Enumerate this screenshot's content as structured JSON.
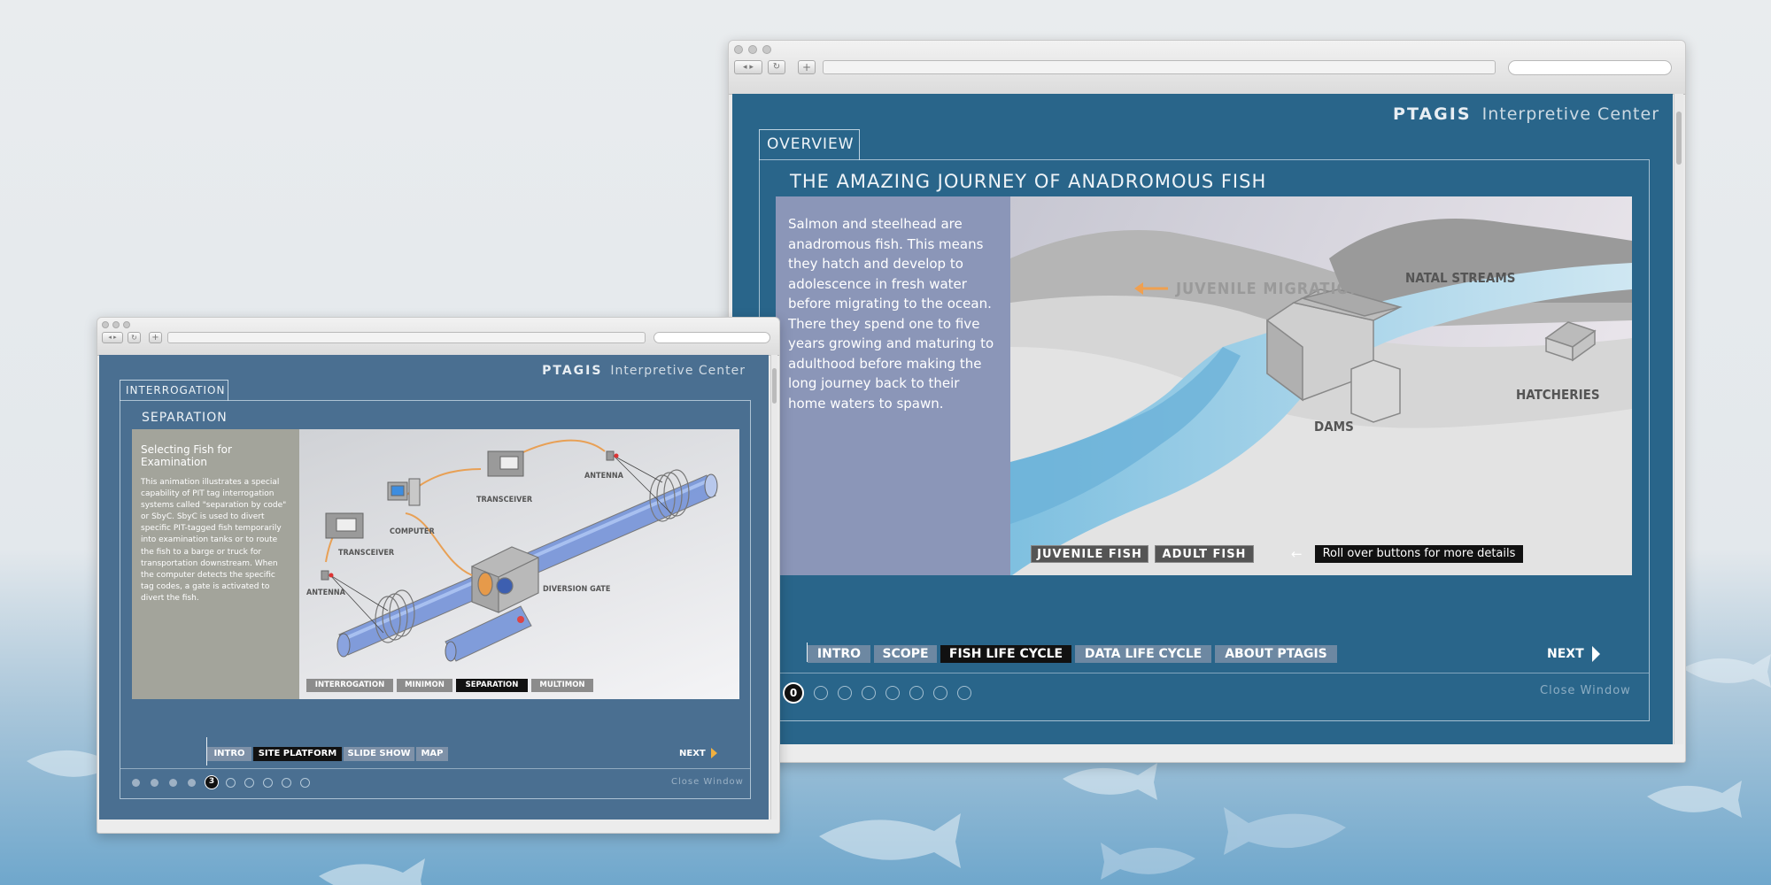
{
  "colors": {
    "page_bg": "#e6eaed",
    "water": "#7fb3d6",
    "panel_blue": "#29658a",
    "nav_active": "#111111",
    "accent_orange": "#f0a050"
  },
  "left_window": {
    "brand_bold": "PTAGIS",
    "brand_light": "Interpretive Center",
    "tab": "INTERROGATION",
    "heading": "SEPARATION",
    "panel_title": "Selecting Fish for Examination",
    "panel_body": "This animation illustrates a special capability of PIT tag interrogation systems called \"separation by code\" or SbyC. SbyC is used to divert specific PIT-tagged fish temporarily into examination tanks or to route the fish to a barge or truck for transportation downstream. When the computer detects the specific tag codes, a gate is activated to divert the fish.",
    "diagram_labels": {
      "transceiver_top": "TRANSCEIVER",
      "antenna_top": "ANTENNA",
      "computer": "COMPUTER",
      "transceiver_left": "TRANSCEIVER",
      "antenna_left": "ANTENNA",
      "diversion_gate": "DIVERSION GATE"
    },
    "sub_tabs": [
      {
        "label": "INTERROGATION",
        "active": false
      },
      {
        "label": "MINIMON",
        "active": false
      },
      {
        "label": "SEPARATION",
        "active": true
      },
      {
        "label": "MULTIMON",
        "active": false
      }
    ],
    "nav": [
      {
        "label": "INTRO",
        "active": false
      },
      {
        "label": "SITE PLATFORM",
        "active": true
      },
      {
        "label": "SLIDE SHOW",
        "active": false
      },
      {
        "label": "MAP",
        "active": false
      }
    ],
    "next_label": "NEXT",
    "current_page": "3",
    "close_label": "Close Window"
  },
  "right_window": {
    "brand_bold": "PTAGIS",
    "brand_light": "Interpretive Center",
    "tab": "OVERVIEW",
    "heading": "THE AMAZING JOURNEY OF ANADROMOUS FISH",
    "panel_body": "Salmon and steelhead are anadromous fish. This means they hatch and develop to adolescence in fresh water before migrating to the ocean. There they spend one to five years growing and maturing to adulthood before making the long journey back to their home waters to spawn.",
    "map_labels": {
      "juvenile_migration": "JUVENILE MIGRATION",
      "natal_streams": "NATAL STREAMS",
      "hatcheries": "HATCHERIES",
      "dams": "DAMS"
    },
    "fish_buttons": [
      "JUVENILE FISH",
      "ADULT FISH"
    ],
    "hint": "Roll over buttons for more details",
    "nav": [
      {
        "label": "INTRO",
        "active": false
      },
      {
        "label": "SCOPE",
        "active": false
      },
      {
        "label": "FISH LIFE CYCLE",
        "active": true
      },
      {
        "label": "DATA LIFE CYCLE",
        "active": false
      },
      {
        "label": "ABOUT PTAGIS",
        "active": false
      }
    ],
    "next_label": "NEXT",
    "current_page": "0",
    "close_label": "Close Window"
  }
}
